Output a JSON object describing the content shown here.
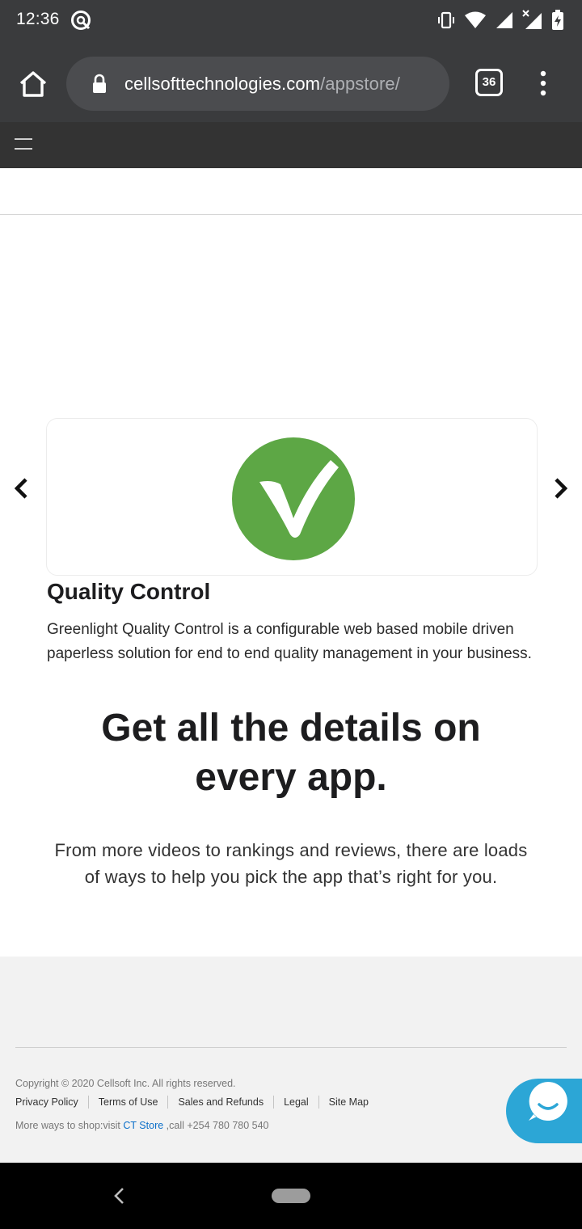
{
  "status_bar": {
    "time": "12:36",
    "icons": [
      "sync-icon",
      "vibrate-icon",
      "wifi-icon",
      "signal-icon",
      "signal-x-icon",
      "battery-charging-icon"
    ]
  },
  "browser": {
    "url_domain": "cellsofttechnologies.com",
    "url_path": "/appstore/",
    "tab_count": "36"
  },
  "carousel": {
    "app": {
      "title": "Quality Control",
      "description": "Greenlight Quality Control is a configurable web based mobile driven paperless solution for end to end quality management in your business.",
      "logo_color": "#5da745"
    }
  },
  "hero": {
    "title": "Get all the details on every app.",
    "subtitle": "From more videos to rankings and reviews, there are loads of ways to help you pick the app that’s right for you."
  },
  "footer": {
    "copyright": "Copyright © 2020 Cellsoft Inc. All rights reserved.",
    "links": [
      "Privacy Policy",
      "Terms of Use",
      "Sales and Refunds",
      "Legal",
      "Site Map"
    ],
    "shop_prefix": "More ways to shop:visit ",
    "shop_link": "CT Store",
    "shop_suffix": " ,call +254 780 780 540"
  },
  "colors": {
    "chrome": "#3a3b3d",
    "site_nav": "#333333",
    "accent_link": "#0b6fc9",
    "chat": "#2ca6d6"
  }
}
